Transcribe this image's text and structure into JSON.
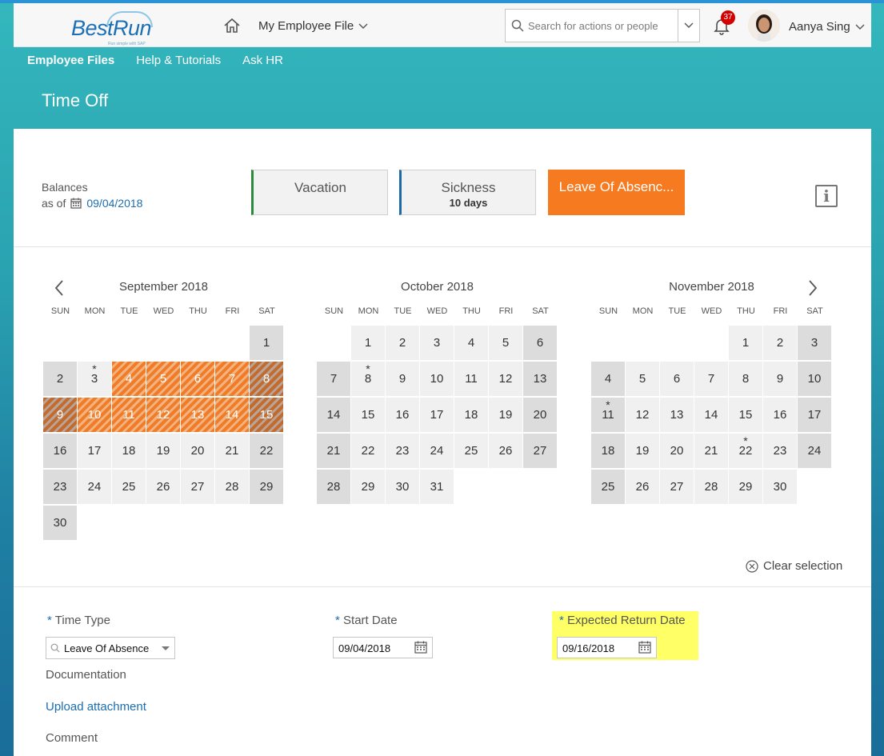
{
  "shell": {
    "logo_text": "BestRun",
    "logo_tagline": "Run simple with SAP",
    "menu_title": "My Employee File",
    "search_placeholder": "Search for actions or people",
    "notification_count": "37",
    "user_name": "Aanya Sing"
  },
  "subnav": {
    "items": [
      "Employee Files",
      "Help & Tutorials",
      "Ask HR"
    ]
  },
  "page": {
    "title": "Time Off"
  },
  "balances": {
    "label": "Balances",
    "as_of": "as of",
    "date": "09/04/2018",
    "tiles": [
      {
        "name": "Vacation",
        "value": ""
      },
      {
        "name": "Sickness",
        "value": "10 days"
      },
      {
        "name": "Leave Of Absenc..."
      }
    ]
  },
  "calendar": {
    "weekdays": [
      "SUN",
      "MON",
      "TUE",
      "WED",
      "THU",
      "FRI",
      "SAT"
    ],
    "months": [
      {
        "title": "September 2018",
        "first_weekday": 6,
        "days": 30,
        "starred": [
          3
        ],
        "selected": [
          4,
          5,
          6,
          7,
          8,
          9,
          10,
          11,
          12,
          13,
          14,
          15
        ]
      },
      {
        "title": "October 2018",
        "first_weekday": 1,
        "days": 31,
        "starred": [
          8
        ],
        "selected": []
      },
      {
        "title": "November 2018",
        "first_weekday": 4,
        "days": 30,
        "starred": [
          11,
          22
        ],
        "selected": []
      }
    ],
    "clear_selection": "Clear selection"
  },
  "form": {
    "time_type_label": "Time Type",
    "time_type_value": "Leave Of Absence",
    "start_date_label": "Start Date",
    "start_date_value": "09/04/2018",
    "return_date_label": "Expected Return Date",
    "return_date_value": "09/16/2018",
    "required_mark": "*",
    "documentation_label": "Documentation",
    "upload_link": "Upload attachment",
    "comment_label": "Comment"
  },
  "colors": {
    "accent": "#f57a20",
    "brand": "#1b6fb4",
    "highlight": "#ffff66"
  }
}
